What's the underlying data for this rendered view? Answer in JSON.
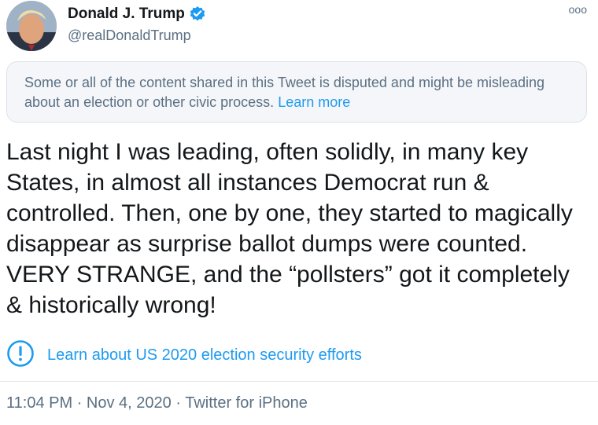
{
  "author": {
    "display_name": "Donald J. Trump",
    "handle": "@realDonaldTrump",
    "verified": true
  },
  "more_menu": "ooo",
  "notice": {
    "text": "Some or all of the content shared in this Tweet is disputed and might be misleading about an election or other civic process.",
    "link": "Learn more"
  },
  "tweet": {
    "text": "Last night I was leading, often solidly, in many key States, in almost all instances Democrat run & controlled. Then, one by one, they started to magically disappear as surprise ballot dumps were counted. VERY STRANGE, and the “pollsters” got it completely & historically wrong!"
  },
  "election_info": {
    "icon": "exclamation-circle-icon",
    "link": "Learn about US 2020 election security efforts"
  },
  "meta": {
    "time": "11:04 PM",
    "date": "Nov 4, 2020",
    "source": "Twitter for iPhone",
    "separator": "·"
  },
  "colors": {
    "link": "#1d9bf0",
    "secondary_text": "#5b7083",
    "notice_bg": "#f4f6f9"
  }
}
